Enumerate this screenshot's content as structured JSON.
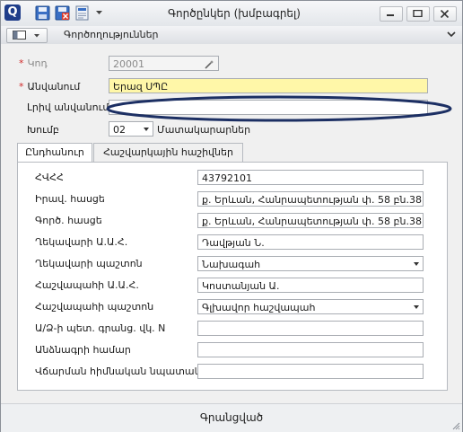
{
  "window": {
    "title": "Գործընկեր (խմբագրել)",
    "app_icon_letter": "Q",
    "subbar_label": "Գործողություններ"
  },
  "form": {
    "code_label": "Կոդ",
    "code_value": "20001",
    "name_label": "Անվանում",
    "name_value": "Երազ ՍՊԸ",
    "fullname_label": "Լրիվ անվանում",
    "fullname_value": "",
    "group_label": "Խումբ",
    "group_value": "02",
    "group_description": "Մատակարարներ"
  },
  "tabs": [
    {
      "label": "Ընդհանուր",
      "active": true
    },
    {
      "label": "Հաշվարկային հաշիվներ",
      "active": false
    }
  ],
  "general": {
    "tin_label": "ՀՎՀՀ",
    "tin_value": "43792101",
    "legal_address_label": "Իրավ. հասցե",
    "legal_address_value": "ք. Երևան, Հանրապետության փ. 58 բն.38",
    "actual_address_label": "Գործ. հասցե",
    "actual_address_value": "ք. Երևան, Հանրապետության փ. 58 բն.38",
    "director_name_label": "Ղեկավարի Ա.Ա.Հ.",
    "director_name_value": "Դավթյան Ն.",
    "director_position_label": "Ղեկավարի պաշտոն",
    "director_position_value": "Նախագահ",
    "accountant_name_label": "Հաշվապահի Ա.Ա.Հ.",
    "accountant_name_value": "Կոստանյան Ա.",
    "accountant_position_label": "Հաշվապահի պաշտոն",
    "accountant_position_value": "Գլխավոր հաշվապահ",
    "registration_label": "Ա/Ձ-ի պետ. գրանց. վկ. N",
    "registration_value": "",
    "passport_label": "Անձնագրի համար",
    "passport_value": "",
    "payment_basis_label": "Վճարման հիմնական նպատակ",
    "payment_basis_value": ""
  },
  "status": {
    "text": "Գրանցված"
  },
  "colors": {
    "name_highlight": "#fff7a8",
    "required_star": "#d12a2a",
    "annotation_ellipse": "#1c2f63"
  }
}
